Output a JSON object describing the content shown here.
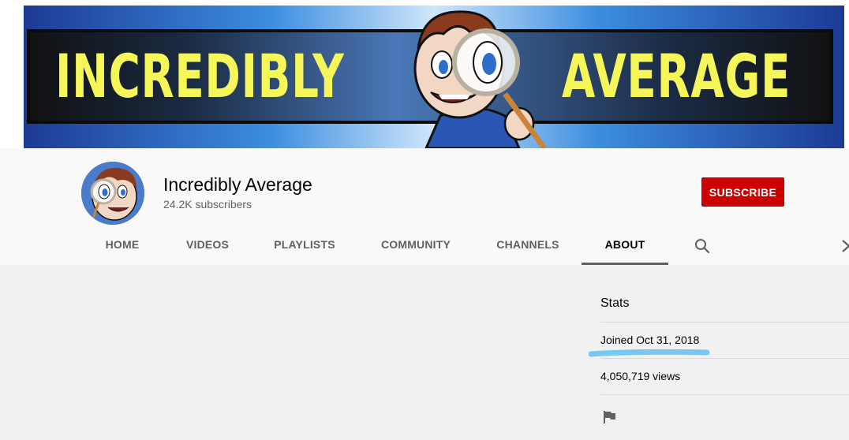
{
  "banner": {
    "text_left": "INCREDIBLY",
    "text_right": "AVERAGE",
    "text_color": "#f4f65a"
  },
  "channel": {
    "name": "Incredibly Average",
    "subscribers": "24.2K subscribers",
    "avatar_icon": "cartoon-magnifier-avatar"
  },
  "subscribe": {
    "label": "SUBSCRIBE",
    "color": "#cc0000"
  },
  "tabs": [
    {
      "label": "HOME"
    },
    {
      "label": "VIDEOS"
    },
    {
      "label": "PLAYLISTS"
    },
    {
      "label": "COMMUNITY"
    },
    {
      "label": "CHANNELS"
    },
    {
      "label": "ABOUT",
      "active": true
    }
  ],
  "tab_icons": {
    "search": "search-icon",
    "more": "chevron-right-icon"
  },
  "stats": {
    "title": "Stats",
    "joined": "Joined Oct 31, 2018",
    "views": "4,050,719 views",
    "report_icon": "flag-icon",
    "highlight_color": "#79c8f2"
  }
}
